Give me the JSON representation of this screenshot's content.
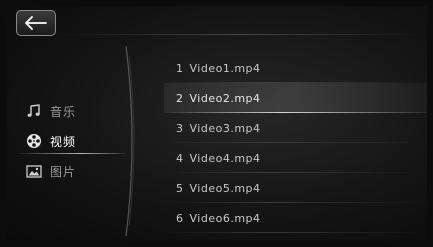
{
  "header": {
    "back_icon": "arrow-left-icon"
  },
  "sidebar": {
    "items": [
      {
        "label": "音乐",
        "icon": "music-note-icon",
        "active": false
      },
      {
        "label": "视频",
        "icon": "film-reel-icon",
        "active": true
      },
      {
        "label": "图片",
        "icon": "picture-icon",
        "active": false
      }
    ]
  },
  "video_list": {
    "items": [
      {
        "index": "1",
        "name": "Video1.mp4",
        "selected": false
      },
      {
        "index": "2",
        "name": "Video2.mp4",
        "selected": true
      },
      {
        "index": "3",
        "name": "Video3.mp4",
        "selected": false
      },
      {
        "index": "4",
        "name": "Video4.mp4",
        "selected": false
      },
      {
        "index": "5",
        "name": "Video5.mp4",
        "selected": false
      },
      {
        "index": "6",
        "name": "Video6.mp4",
        "selected": false
      }
    ]
  },
  "colors": {
    "background": "#141414",
    "text_active": "#ffffff",
    "text_inactive": "#9a9a9a"
  }
}
